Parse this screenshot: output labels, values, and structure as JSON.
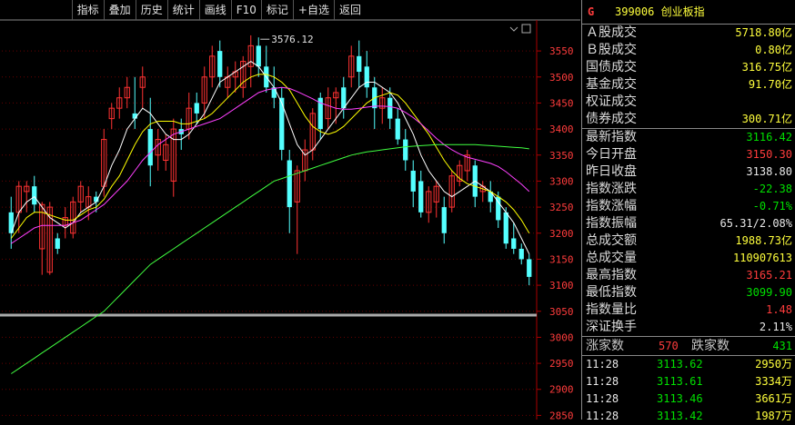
{
  "toolbar": [
    "指标",
    "叠加",
    "历史",
    "统计",
    "画线",
    "F10",
    "标记",
    "+自选",
    "返回"
  ],
  "chart_data": {
    "type": "candlestick",
    "y_ticks": [
      3550,
      3500,
      3450,
      3400,
      3350,
      3300,
      3250,
      3200,
      3150,
      3100,
      3050,
      3000,
      2950,
      2900,
      2850
    ],
    "ylim": [
      2842,
      3606
    ],
    "annotation": "3576.12",
    "ohlc": [
      [
        3240,
        3270,
        3170,
        3200
      ],
      [
        3240,
        3300,
        3200,
        3290
      ],
      [
        3280,
        3300,
        3240,
        3290
      ],
      [
        3290,
        3310,
        3240,
        3255
      ],
      [
        3170,
        3260,
        3120,
        3255
      ],
      [
        3125,
        3260,
        3120,
        3250
      ],
      [
        3190,
        3200,
        3160,
        3170
      ],
      [
        3215,
        3250,
        3190,
        3230
      ],
      [
        3200,
        3270,
        3190,
        3260
      ],
      [
        3260,
        3300,
        3240,
        3290
      ],
      [
        3250,
        3290,
        3225,
        3270
      ],
      [
        3270,
        3280,
        3240,
        3260
      ],
      [
        3290,
        3400,
        3270,
        3380
      ],
      [
        3420,
        3450,
        3400,
        3440
      ],
      [
        3440,
        3480,
        3420,
        3460
      ],
      [
        3460,
        3500,
        3440,
        3480
      ],
      [
        3430,
        3500,
        3400,
        3420
      ],
      [
        3480,
        3520,
        3440,
        3500
      ],
      [
        3400,
        3460,
        3290,
        3330
      ],
      [
        3350,
        3400,
        3320,
        3380
      ],
      [
        3340,
        3390,
        3320,
        3370
      ],
      [
        3300,
        3420,
        3270,
        3400
      ],
      [
        3400,
        3420,
        3360,
        3390
      ],
      [
        3400,
        3470,
        3380,
        3440
      ],
      [
        3450,
        3470,
        3410,
        3430
      ],
      [
        3450,
        3520,
        3420,
        3500
      ],
      [
        3500,
        3560,
        3480,
        3540
      ],
      [
        3550,
        3570,
        3480,
        3500
      ],
      [
        3480,
        3520,
        3460,
        3500
      ],
      [
        3500,
        3530,
        3470,
        3510
      ],
      [
        3480,
        3540,
        3460,
        3530
      ],
      [
        3520,
        3580,
        3480,
        3560
      ],
      [
        3560,
        3576,
        3500,
        3520
      ],
      [
        3520,
        3560,
        3470,
        3480
      ],
      [
        3480,
        3520,
        3440,
        3460
      ],
      [
        3460,
        3480,
        3340,
        3360
      ],
      [
        3340,
        3360,
        3200,
        3250
      ],
      [
        3260,
        3330,
        3160,
        3320
      ],
      [
        3320,
        3380,
        3300,
        3360
      ],
      [
        3360,
        3440,
        3340,
        3430
      ],
      [
        3460,
        3470,
        3380,
        3400
      ],
      [
        3420,
        3480,
        3400,
        3460
      ],
      [
        3460,
        3480,
        3410,
        3470
      ],
      [
        3480,
        3500,
        3420,
        3440
      ],
      [
        3500,
        3560,
        3480,
        3540
      ],
      [
        3540,
        3570,
        3480,
        3510
      ],
      [
        3520,
        3550,
        3460,
        3480
      ],
      [
        3480,
        3500,
        3400,
        3440
      ],
      [
        3440,
        3480,
        3410,
        3460
      ],
      [
        3460,
        3480,
        3400,
        3420
      ],
      [
        3420,
        3440,
        3370,
        3380
      ],
      [
        3380,
        3400,
        3320,
        3340
      ],
      [
        3320,
        3340,
        3250,
        3280
      ],
      [
        3300,
        3320,
        3230,
        3240
      ],
      [
        3240,
        3290,
        3220,
        3280
      ],
      [
        3260,
        3300,
        3230,
        3290
      ],
      [
        3250,
        3270,
        3180,
        3200
      ],
      [
        3250,
        3320,
        3240,
        3310
      ],
      [
        3300,
        3340,
        3290,
        3330
      ],
      [
        3320,
        3360,
        3300,
        3350
      ],
      [
        3330,
        3340,
        3250,
        3270
      ],
      [
        3280,
        3300,
        3260,
        3290
      ],
      [
        3280,
        3300,
        3240,
        3260
      ],
      [
        3270,
        3280,
        3210,
        3225
      ],
      [
        3240,
        3250,
        3170,
        3180
      ],
      [
        3190,
        3220,
        3160,
        3170
      ],
      [
        3170,
        3180,
        3140,
        3150
      ],
      [
        3150,
        3160,
        3100,
        3116
      ]
    ],
    "ma_series": [
      {
        "color": "#ffffff",
        "values": [
          3200,
          3240,
          3260,
          3270,
          3250,
          3230,
          3220,
          3210,
          3220,
          3240,
          3250,
          3260,
          3290,
          3330,
          3360,
          3400,
          3420,
          3440,
          3430,
          3410,
          3390,
          3380,
          3380,
          3390,
          3410,
          3430,
          3460,
          3490,
          3500,
          3510,
          3520,
          3530,
          3520,
          3500,
          3480,
          3450,
          3410,
          3370,
          3350,
          3360,
          3380,
          3400,
          3420,
          3440,
          3460,
          3480,
          3490,
          3490,
          3480,
          3470,
          3450,
          3420,
          3390,
          3350,
          3320,
          3300,
          3280,
          3270,
          3280,
          3290,
          3300,
          3290,
          3280,
          3260,
          3240,
          3220,
          3190,
          3160
        ]
      },
      {
        "color": "#ffff00",
        "values": [
          3190,
          3210,
          3230,
          3240,
          3240,
          3235,
          3230,
          3225,
          3225,
          3235,
          3245,
          3250,
          3265,
          3290,
          3310,
          3340,
          3370,
          3395,
          3410,
          3415,
          3415,
          3415,
          3410,
          3410,
          3415,
          3420,
          3430,
          3445,
          3460,
          3475,
          3490,
          3500,
          3505,
          3505,
          3500,
          3490,
          3475,
          3450,
          3425,
          3405,
          3395,
          3390,
          3395,
          3405,
          3420,
          3435,
          3450,
          3460,
          3465,
          3470,
          3465,
          3450,
          3430,
          3410,
          3390,
          3365,
          3340,
          3320,
          3305,
          3295,
          3290,
          3285,
          3280,
          3270,
          3260,
          3245,
          3225,
          3200
        ]
      },
      {
        "color": "#ff40ff",
        "values": [
          3180,
          3190,
          3200,
          3210,
          3215,
          3215,
          3215,
          3215,
          3220,
          3225,
          3235,
          3245,
          3255,
          3270,
          3285,
          3300,
          3320,
          3340,
          3355,
          3370,
          3380,
          3390,
          3395,
          3400,
          3405,
          3410,
          3415,
          3420,
          3430,
          3440,
          3450,
          3460,
          3470,
          3475,
          3478,
          3480,
          3478,
          3472,
          3465,
          3458,
          3450,
          3445,
          3440,
          3438,
          3438,
          3440,
          3442,
          3444,
          3444,
          3443,
          3440,
          3432,
          3422,
          3410,
          3396,
          3382,
          3370,
          3360,
          3352,
          3346,
          3342,
          3338,
          3334,
          3328,
          3318,
          3306,
          3294,
          3280
        ]
      },
      {
        "color": "#40ff40",
        "values": [
          2930,
          2940,
          2950,
          2960,
          2970,
          2980,
          2990,
          3000,
          3010,
          3020,
          3030,
          3040,
          3050,
          3065,
          3080,
          3095,
          3110,
          3125,
          3140,
          3150,
          3160,
          3170,
          3180,
          3190,
          3200,
          3210,
          3220,
          3230,
          3240,
          3250,
          3260,
          3270,
          3280,
          3290,
          3300,
          3305,
          3310,
          3315,
          3320,
          3325,
          3330,
          3335,
          3340,
          3345,
          3350,
          3353,
          3356,
          3358,
          3360,
          3362,
          3364,
          3366,
          3367,
          3368,
          3369,
          3370,
          3370,
          3370,
          3370,
          3370,
          3370,
          3369,
          3368,
          3367,
          3366,
          3365,
          3364,
          3362
        ]
      }
    ]
  },
  "quote": {
    "market": "G",
    "code": "399006",
    "name": "创业板指",
    "rows1": [
      {
        "label": "Ａ股成交",
        "value": "5718.80亿",
        "cls": "yellow"
      },
      {
        "label": "Ｂ股成交",
        "value": "0.80亿",
        "cls": "yellow"
      },
      {
        "label": "国债成交",
        "value": "316.75亿",
        "cls": "yellow"
      },
      {
        "label": "基金成交",
        "value": "91.70亿",
        "cls": "yellow"
      },
      {
        "label": "权证成交",
        "value": "",
        "cls": "yellow"
      },
      {
        "label": "债券成交",
        "value": "300.71亿",
        "cls": "yellow"
      }
    ],
    "rows2": [
      {
        "label": "最新指数",
        "value": "3116.42",
        "cls": "green"
      },
      {
        "label": "今日开盘",
        "value": "3150.30",
        "cls": "red"
      },
      {
        "label": "昨日收盘",
        "value": "3138.80",
        "cls": "white"
      },
      {
        "label": "指数涨跌",
        "value": "-22.38",
        "cls": "green"
      },
      {
        "label": "指数涨幅",
        "value": "-0.71%",
        "cls": "green"
      },
      {
        "label": "指数振幅",
        "value": "65.31/2.08%",
        "cls": "white"
      },
      {
        "label": "总成交额",
        "value": "1988.73亿",
        "cls": "yellow"
      },
      {
        "label": "总成交量",
        "value": "110907613",
        "cls": "yellow"
      },
      {
        "label": "最高指数",
        "value": "3165.21",
        "cls": "red"
      },
      {
        "label": "最低指数",
        "value": "3099.90",
        "cls": "green"
      },
      {
        "label": "指数量比",
        "value": "1.48",
        "cls": "red"
      },
      {
        "label": "深证换手",
        "value": "2.11%",
        "cls": "white"
      }
    ],
    "up_label": "涨家数",
    "up_value": "570",
    "down_label": "跌家数",
    "down_value": "431",
    "ticks": [
      {
        "time": "11:28",
        "price": "3113.62",
        "vol": "2950万"
      },
      {
        "time": "11:28",
        "price": "3113.61",
        "vol": "3334万"
      },
      {
        "time": "11:28",
        "price": "3113.46",
        "vol": "3661万"
      },
      {
        "time": "11:28",
        "price": "3113.42",
        "vol": "1987万"
      }
    ]
  }
}
